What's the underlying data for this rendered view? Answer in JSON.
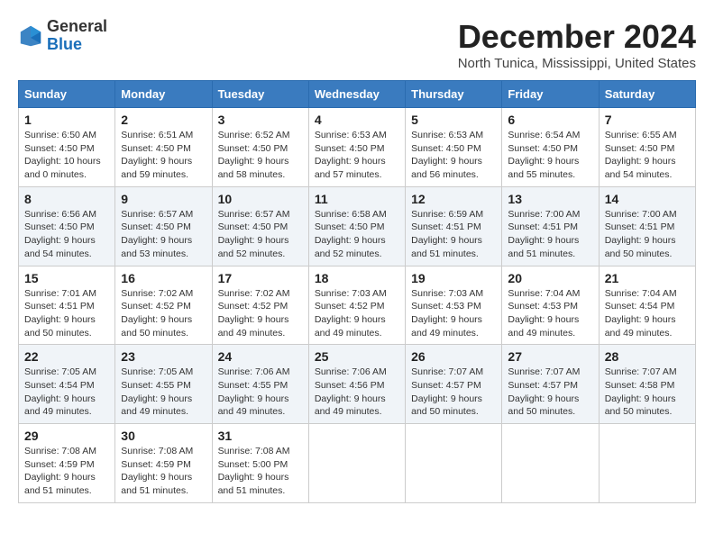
{
  "logo": {
    "general": "General",
    "blue": "Blue"
  },
  "title": "December 2024",
  "location": "North Tunica, Mississippi, United States",
  "headers": [
    "Sunday",
    "Monday",
    "Tuesday",
    "Wednesday",
    "Thursday",
    "Friday",
    "Saturday"
  ],
  "weeks": [
    [
      {
        "day": "1",
        "info": "Sunrise: 6:50 AM\nSunset: 4:50 PM\nDaylight: 10 hours\nand 0 minutes."
      },
      {
        "day": "2",
        "info": "Sunrise: 6:51 AM\nSunset: 4:50 PM\nDaylight: 9 hours\nand 59 minutes."
      },
      {
        "day": "3",
        "info": "Sunrise: 6:52 AM\nSunset: 4:50 PM\nDaylight: 9 hours\nand 58 minutes."
      },
      {
        "day": "4",
        "info": "Sunrise: 6:53 AM\nSunset: 4:50 PM\nDaylight: 9 hours\nand 57 minutes."
      },
      {
        "day": "5",
        "info": "Sunrise: 6:53 AM\nSunset: 4:50 PM\nDaylight: 9 hours\nand 56 minutes."
      },
      {
        "day": "6",
        "info": "Sunrise: 6:54 AM\nSunset: 4:50 PM\nDaylight: 9 hours\nand 55 minutes."
      },
      {
        "day": "7",
        "info": "Sunrise: 6:55 AM\nSunset: 4:50 PM\nDaylight: 9 hours\nand 54 minutes."
      }
    ],
    [
      {
        "day": "8",
        "info": "Sunrise: 6:56 AM\nSunset: 4:50 PM\nDaylight: 9 hours\nand 54 minutes."
      },
      {
        "day": "9",
        "info": "Sunrise: 6:57 AM\nSunset: 4:50 PM\nDaylight: 9 hours\nand 53 minutes."
      },
      {
        "day": "10",
        "info": "Sunrise: 6:57 AM\nSunset: 4:50 PM\nDaylight: 9 hours\nand 52 minutes."
      },
      {
        "day": "11",
        "info": "Sunrise: 6:58 AM\nSunset: 4:50 PM\nDaylight: 9 hours\nand 52 minutes."
      },
      {
        "day": "12",
        "info": "Sunrise: 6:59 AM\nSunset: 4:51 PM\nDaylight: 9 hours\nand 51 minutes."
      },
      {
        "day": "13",
        "info": "Sunrise: 7:00 AM\nSunset: 4:51 PM\nDaylight: 9 hours\nand 51 minutes."
      },
      {
        "day": "14",
        "info": "Sunrise: 7:00 AM\nSunset: 4:51 PM\nDaylight: 9 hours\nand 50 minutes."
      }
    ],
    [
      {
        "day": "15",
        "info": "Sunrise: 7:01 AM\nSunset: 4:51 PM\nDaylight: 9 hours\nand 50 minutes."
      },
      {
        "day": "16",
        "info": "Sunrise: 7:02 AM\nSunset: 4:52 PM\nDaylight: 9 hours\nand 50 minutes."
      },
      {
        "day": "17",
        "info": "Sunrise: 7:02 AM\nSunset: 4:52 PM\nDaylight: 9 hours\nand 49 minutes."
      },
      {
        "day": "18",
        "info": "Sunrise: 7:03 AM\nSunset: 4:52 PM\nDaylight: 9 hours\nand 49 minutes."
      },
      {
        "day": "19",
        "info": "Sunrise: 7:03 AM\nSunset: 4:53 PM\nDaylight: 9 hours\nand 49 minutes."
      },
      {
        "day": "20",
        "info": "Sunrise: 7:04 AM\nSunset: 4:53 PM\nDaylight: 9 hours\nand 49 minutes."
      },
      {
        "day": "21",
        "info": "Sunrise: 7:04 AM\nSunset: 4:54 PM\nDaylight: 9 hours\nand 49 minutes."
      }
    ],
    [
      {
        "day": "22",
        "info": "Sunrise: 7:05 AM\nSunset: 4:54 PM\nDaylight: 9 hours\nand 49 minutes."
      },
      {
        "day": "23",
        "info": "Sunrise: 7:05 AM\nSunset: 4:55 PM\nDaylight: 9 hours\nand 49 minutes."
      },
      {
        "day": "24",
        "info": "Sunrise: 7:06 AM\nSunset: 4:55 PM\nDaylight: 9 hours\nand 49 minutes."
      },
      {
        "day": "25",
        "info": "Sunrise: 7:06 AM\nSunset: 4:56 PM\nDaylight: 9 hours\nand 49 minutes."
      },
      {
        "day": "26",
        "info": "Sunrise: 7:07 AM\nSunset: 4:57 PM\nDaylight: 9 hours\nand 50 minutes."
      },
      {
        "day": "27",
        "info": "Sunrise: 7:07 AM\nSunset: 4:57 PM\nDaylight: 9 hours\nand 50 minutes."
      },
      {
        "day": "28",
        "info": "Sunrise: 7:07 AM\nSunset: 4:58 PM\nDaylight: 9 hours\nand 50 minutes."
      }
    ],
    [
      {
        "day": "29",
        "info": "Sunrise: 7:08 AM\nSunset: 4:59 PM\nDaylight: 9 hours\nand 51 minutes."
      },
      {
        "day": "30",
        "info": "Sunrise: 7:08 AM\nSunset: 4:59 PM\nDaylight: 9 hours\nand 51 minutes."
      },
      {
        "day": "31",
        "info": "Sunrise: 7:08 AM\nSunset: 5:00 PM\nDaylight: 9 hours\nand 51 minutes."
      },
      null,
      null,
      null,
      null
    ]
  ]
}
